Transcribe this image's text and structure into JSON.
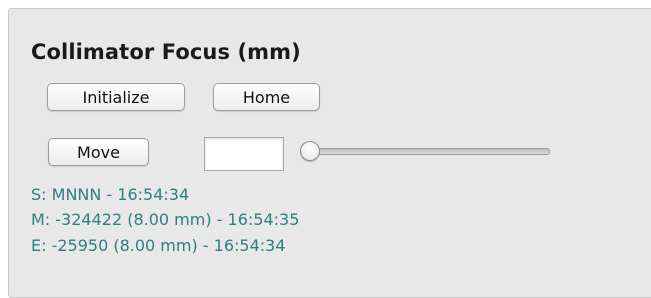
{
  "panel": {
    "title": "Collimator Focus (mm)"
  },
  "buttons": {
    "initialize": "Initialize",
    "home": "Home",
    "move": "Move"
  },
  "position_input": {
    "value": ""
  },
  "slider": {
    "value_fraction": 0.0
  },
  "status": {
    "s_line": "S: MNNN - 16:54:34",
    "m_line": "M: -324422 (8.00 mm) - 16:54:35",
    "e_line": "E: -25950 (8.00 mm) - 16:54:34"
  },
  "colors": {
    "panel_bg": "#e8e8e8",
    "status_text": "#2f7e80"
  }
}
